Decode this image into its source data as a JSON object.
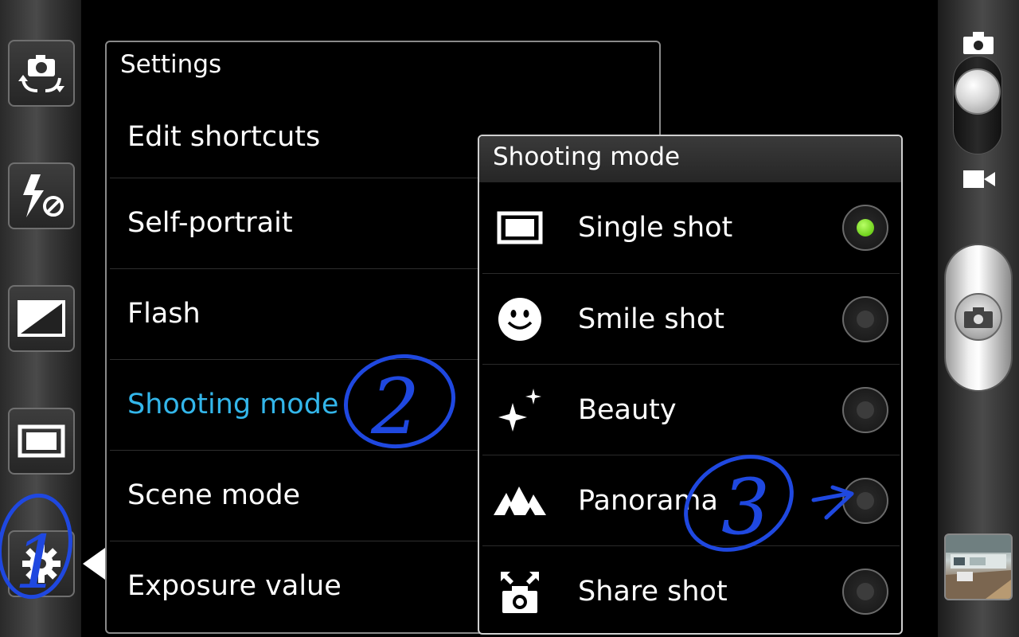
{
  "toolbar": {
    "icons": [
      "camera-switch-icon",
      "flash-off-icon",
      "exposure-icon",
      "single-shot-mode-icon",
      "gear-icon"
    ]
  },
  "settings": {
    "title": "Settings",
    "items": [
      {
        "label": "Edit shortcuts",
        "active": false
      },
      {
        "label": "Self-portrait",
        "active": false
      },
      {
        "label": "Flash",
        "active": false
      },
      {
        "label": "Shooting mode",
        "active": true
      },
      {
        "label": "Scene mode",
        "active": false
      },
      {
        "label": "Exposure value",
        "active": false
      }
    ]
  },
  "shooting_mode": {
    "title": "Shooting mode",
    "options": [
      {
        "label": "Single shot",
        "icon": "single-shot-icon",
        "selected": true
      },
      {
        "label": "Smile shot",
        "icon": "smile-icon",
        "selected": false
      },
      {
        "label": "Beauty",
        "icon": "sparkle-icon",
        "selected": false
      },
      {
        "label": "Panorama",
        "icon": "mountains-icon",
        "selected": false
      },
      {
        "label": "Share shot",
        "icon": "share-camera-icon",
        "selected": false
      }
    ]
  },
  "right_bar": {
    "mode_icons": [
      "camera-mode-icon",
      "video-mode-icon"
    ],
    "shutter_icon": "camera-icon"
  },
  "annotations": {
    "step1": "1",
    "step2": "2",
    "step3": "3"
  },
  "colors": {
    "active_text": "#33b6ea",
    "radio_selected": "#6fd11c",
    "annotation_ink": "#1f48e0"
  }
}
